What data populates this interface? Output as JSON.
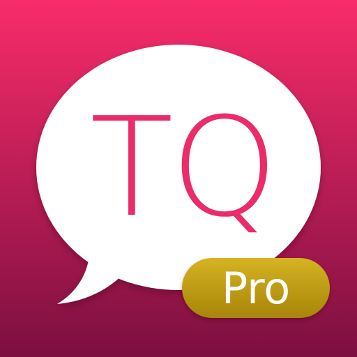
{
  "icon": {
    "logo_text": "TQ",
    "badge_label": "Pro"
  },
  "colors": {
    "background_top": "#f82c6a",
    "background_bottom": "#7c0f40",
    "bubble": "#ffffff",
    "logo_text": "#ec2b69",
    "badge_top": "#d5b323",
    "badge_bottom": "#a88507",
    "badge_text": "#ffffff"
  },
  "icons": [
    "speech-bubble-icon"
  ]
}
